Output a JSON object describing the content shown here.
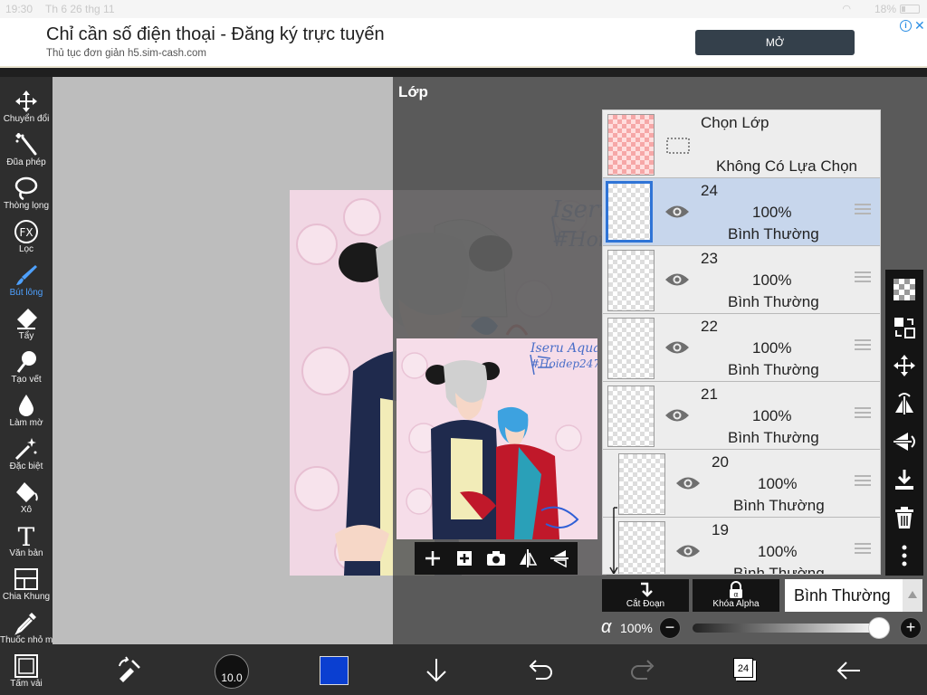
{
  "status": {
    "time": "19:30",
    "date": "Th 6 26 thg 11",
    "battery": "18%"
  },
  "ad": {
    "title": "Chỉ cần số điện thoại - Đăng ký trực tuyến",
    "subtitle": "Thủ tục đơn giản h5.sim-cash.com",
    "button": "MỞ"
  },
  "left_tools": [
    {
      "label": "Chuyển đổi",
      "icon": "move-icon"
    },
    {
      "label": "Đũa phép",
      "icon": "magic-wand-icon"
    },
    {
      "label": "Thòng lọng",
      "icon": "lasso-icon"
    },
    {
      "label": "Lọc",
      "icon": "fx-icon"
    },
    {
      "label": "Bút lông",
      "icon": "brush-icon",
      "active": true
    },
    {
      "label": "Tẩy",
      "icon": "eraser-icon"
    },
    {
      "label": "Tạo vết",
      "icon": "smudge-icon"
    },
    {
      "label": "Làm mờ",
      "icon": "blur-icon"
    },
    {
      "label": "Đặc biệt",
      "icon": "special-icon"
    },
    {
      "label": "Xô",
      "icon": "bucket-icon"
    },
    {
      "label": "Văn bản",
      "icon": "text-icon"
    },
    {
      "label": "Chia Khung",
      "icon": "frame-divider-icon"
    },
    {
      "label": "Thuốc nhỏ mắt",
      "icon": "eyedropper-icon"
    },
    {
      "label": "Tấm vải",
      "icon": "canvas-icon"
    }
  ],
  "panel": {
    "title": "Lớp",
    "selection": {
      "title": "Chọn Lớp",
      "status": "Không Có Lựa Chọn"
    },
    "layers": [
      {
        "number": "24",
        "opacity": "100%",
        "mode": "Bình Thường",
        "selected": true
      },
      {
        "number": "23",
        "opacity": "100%",
        "mode": "Bình Thường"
      },
      {
        "number": "22",
        "opacity": "100%",
        "mode": "Bình Thường"
      },
      {
        "number": "21",
        "opacity": "100%",
        "mode": "Bình Thường"
      },
      {
        "number": "20",
        "opacity": "100%",
        "mode": "Bình Thường"
      },
      {
        "number": "19",
        "opacity": "100%",
        "mode": "Bình Thường"
      }
    ],
    "clip_label": "Cắt Đoạn",
    "alpha_lock_label": "Khóa Alpha",
    "blend_mode": "Bình Thường",
    "alpha_symbol": "α",
    "alpha_value": "100%",
    "minus": "−",
    "plus": "+"
  },
  "artwork_text": {
    "line1": "Iseru Aqua",
    "line2": "#Hoidep247"
  },
  "bottom": {
    "brush_size": "10.0",
    "layer_count": "24",
    "color": "#0a3fd1"
  },
  "colors": {
    "accent": "#4ea1ff",
    "selected_row": "#c7d6ec",
    "toolbar": "#2e2e2e"
  }
}
